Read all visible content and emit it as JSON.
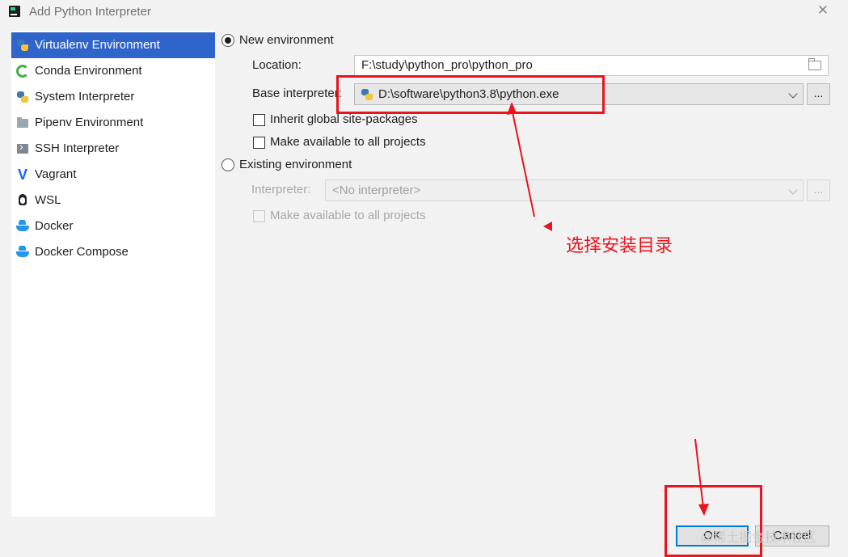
{
  "window": {
    "title": "Add Python Interpreter",
    "close_glyph": "✕"
  },
  "sidebar": {
    "items": [
      {
        "label": "Virtualenv Environment",
        "icon": "python-icon",
        "selected": true
      },
      {
        "label": "Conda Environment",
        "icon": "conda-icon"
      },
      {
        "label": "System Interpreter",
        "icon": "python-icon"
      },
      {
        "label": "Pipenv Environment",
        "icon": "pipenv-icon"
      },
      {
        "label": "SSH Interpreter",
        "icon": "ssh-icon"
      },
      {
        "label": "Vagrant",
        "icon": "vagrant-icon"
      },
      {
        "label": "WSL",
        "icon": "linux-icon"
      },
      {
        "label": "Docker",
        "icon": "docker-icon"
      },
      {
        "label": "Docker Compose",
        "icon": "docker-icon"
      }
    ]
  },
  "new_env": {
    "label": "New environment",
    "location_label": "Location:",
    "location_value": "F:\\study\\python_pro\\python_pro",
    "base_label": "Base interpreter:",
    "base_value": "D:\\software\\python3.8\\python.exe",
    "browse_label": "...",
    "inherit_label": "Inherit global site-packages",
    "make_available_label": "Make available to all projects"
  },
  "existing_env": {
    "label": "Existing environment",
    "interpreter_label": "Interpreter:",
    "interpreter_value": "<No interpreter>",
    "browse_label": "...",
    "make_available_label": "Make available to all projects"
  },
  "annotation": {
    "text": "选择安装目录",
    "color": "#e8141e"
  },
  "buttons": {
    "ok": "OK",
    "cancel": "Cancel"
  },
  "watermark": "@稀土掘金技术社区",
  "colors": {
    "selection": "#2f65ca",
    "annotation": "#e8141e",
    "focus": "#0078d7"
  }
}
